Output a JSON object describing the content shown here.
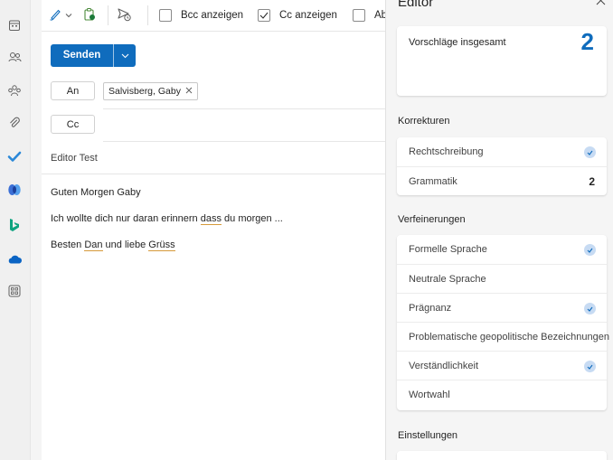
{
  "rail": {
    "icons": [
      "calendar-icon",
      "people-icon",
      "groups-icon",
      "attachment-icon",
      "todo-icon",
      "viva-engage-icon",
      "bing-icon",
      "onedrive-icon",
      "apps-icon"
    ]
  },
  "toolbar": {
    "bcc_label": "Bcc anzeigen",
    "cc_label": "Cc anzeigen",
    "more_label": "Ab"
  },
  "compose": {
    "send_label": "Senden",
    "to_label": "An",
    "cc_label": "Cc",
    "recipient": "Salvisberg, Gaby",
    "subject": "Editor Test",
    "body": {
      "l1": "Guten Morgen Gaby",
      "l2a": "Ich wollte dich nur daran erinnern ",
      "l2b": "dass",
      "l2c": " du morgen ...",
      "l3a": "Besten ",
      "l3b": "Dan",
      "l3c": " und liebe ",
      "l3d": "Grüss"
    }
  },
  "editor": {
    "title": "Editor",
    "total_label": "Vorschläge insgesamt",
    "total_count": "2",
    "corrections_heading": "Korrekturen",
    "corrections": {
      "spelling": "Rechtschreibung",
      "grammar": "Grammatik",
      "grammar_count": "2"
    },
    "refinements_heading": "Verfeinerungen",
    "refinements": {
      "formal": "Formelle Sprache",
      "neutral": "Neutrale Sprache",
      "concise": "Prägnanz",
      "geopolitical": "Problematische geopolitische Bezeichnungen",
      "clarity": "Verständlichkeit",
      "vocabulary": "Wortwahl"
    },
    "settings_heading": "Einstellungen"
  },
  "colors": {
    "accent": "#0f6cbd",
    "check_bg": "#c7dbf3",
    "underline": "#d69a3b",
    "panel_bg": "#f5f5f5"
  }
}
